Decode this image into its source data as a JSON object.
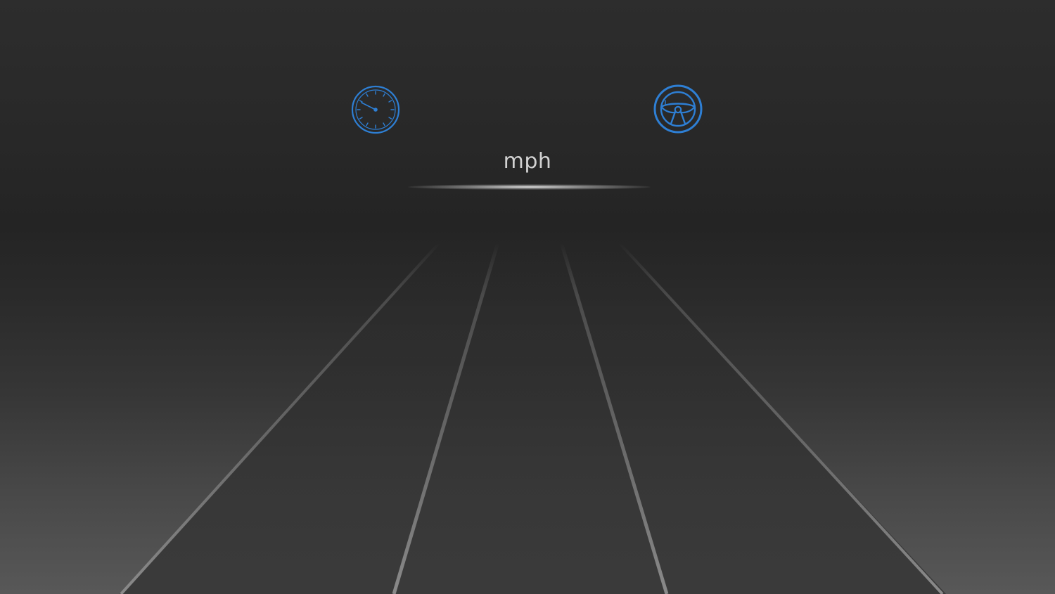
{
  "hud": {
    "speed_unit": "mph",
    "icons": {
      "left": "speedometer-icon",
      "right": "steering-wheel-icon"
    },
    "accent_color": "#2e7fd4",
    "lane_line_color": "#7a7a7a"
  }
}
